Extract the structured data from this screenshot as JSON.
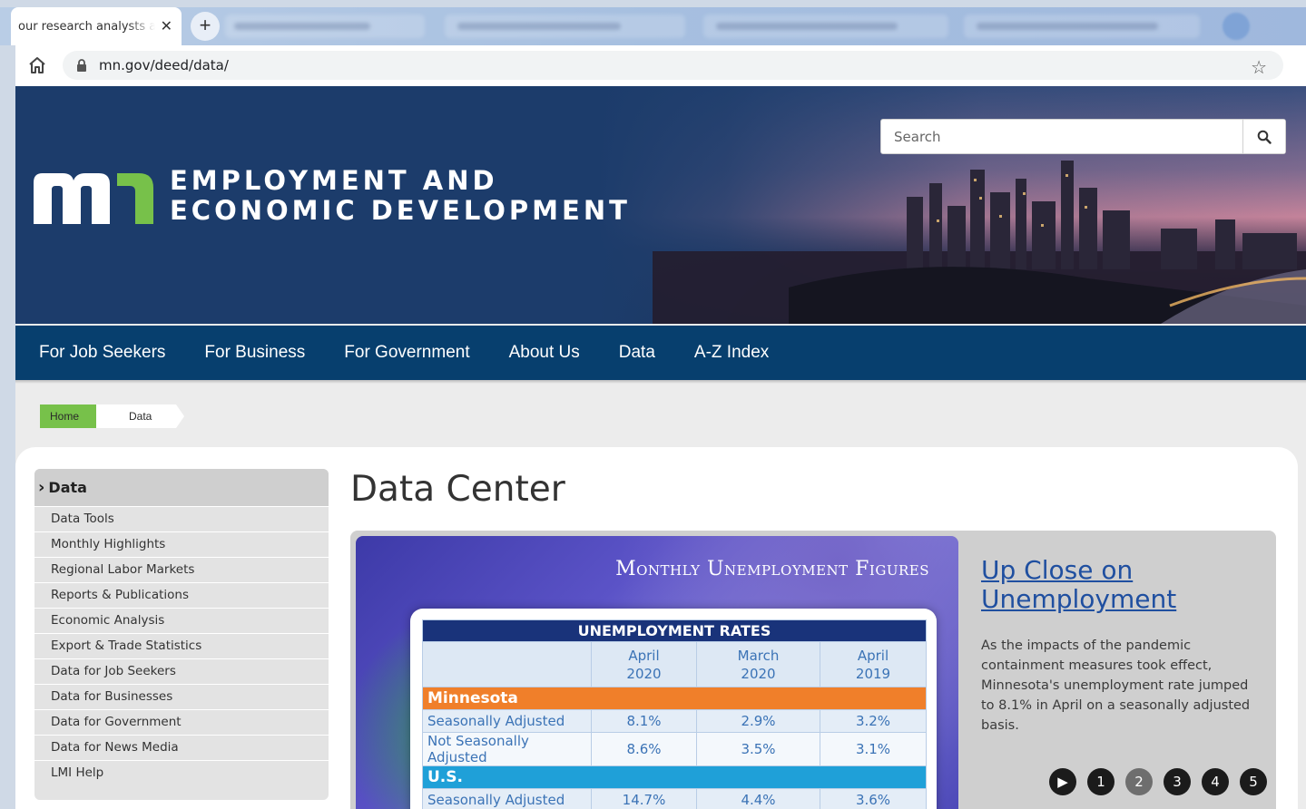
{
  "browser": {
    "tab_title": "our research analysts a",
    "new_tab": "+",
    "close": "✕",
    "url": "mn.gov/deed/data/"
  },
  "header": {
    "agency_line1": "EMPLOYMENT AND",
    "agency_line2": "ECONOMIC DEVELOPMENT",
    "search_placeholder": "Search"
  },
  "nav": {
    "items": [
      "For Job Seekers",
      "For Business",
      "For Government",
      "About Us",
      "Data",
      "A-Z Index"
    ]
  },
  "breadcrumb": {
    "home": "Home",
    "current": "Data"
  },
  "sidebar": {
    "heading": "Data",
    "items": [
      "Data Tools",
      "Monthly Highlights",
      "Regional Labor Markets",
      "Reports & Publications",
      "Economic Analysis",
      "Export & Trade Statistics",
      "Data for Job Seekers",
      "Data for Businesses",
      "Data for Government",
      "Data for News Media",
      "LMI Help"
    ]
  },
  "main": {
    "title": "Data Center",
    "slide": {
      "title": "Monthly Unemployment Figures",
      "table": {
        "heading": "UNEMPLOYMENT RATES",
        "columns": [
          {
            "line1": "April",
            "line2": "2020"
          },
          {
            "line1": "March",
            "line2": "2020"
          },
          {
            "line1": "April",
            "line2": "2019"
          }
        ],
        "regions": [
          {
            "name": "Minnesota",
            "rows": [
              {
                "label": "Seasonally Adjusted",
                "values": [
                  "8.1%",
                  "2.9%",
                  "3.2%"
                ]
              },
              {
                "label": "Not Seasonally Adjusted",
                "values": [
                  "8.6%",
                  "3.5%",
                  "3.1%"
                ]
              }
            ]
          },
          {
            "name": "U.S.",
            "rows": [
              {
                "label": "Seasonally Adjusted",
                "values": [
                  "14.7%",
                  "4.4%",
                  "3.6%"
                ]
              }
            ]
          }
        ]
      }
    },
    "feature_link": "Up Close on Unemployment",
    "feature_text": "As the impacts of the pandemic containment measures took effect, Minnesota's unemployment rate jumped to 8.1% in April on a seasonally adjusted basis.",
    "carousel": {
      "play": "▶",
      "pages": [
        "1",
        "2",
        "3",
        "4",
        "5"
      ],
      "active_page": "2"
    }
  },
  "colors": {
    "nav_bg": "#073f6e",
    "hero_bg": "#1c3c6b",
    "logo_green": "#77c14a",
    "breadcrumb_home": "#77c14a",
    "table_head": "#19337a",
    "mn_band": "#f07f2a",
    "us_band": "#1fa0d8"
  }
}
